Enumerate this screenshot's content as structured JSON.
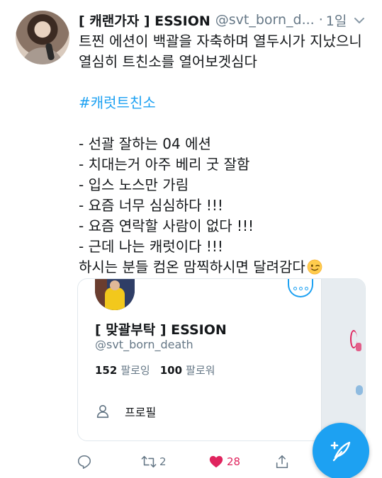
{
  "tweet": {
    "display_name": "[ 캐랜가자 ] ESSION",
    "handle": "@svt_born_d...",
    "separator": "·",
    "time": "1일",
    "lines": {
      "l1": "트찐 에션이 백괄을 자축하며 열두시가 지났으니",
      "l2": "열심히 트친소를 열어보겟심다",
      "hashtag": "#캐럿트친소",
      "l4": "- 선괄 잘하는 04 에션",
      "l5": "- 치대는거 아주 베리 굿 잘함",
      "l6": "- 입스 노스만 가림",
      "l7": "- 요즘 너무 심심하다 !!!",
      "l8": "- 요즘 연락할 사람이 없다 !!!",
      "l9": "- 근데 나는 캐럿이다 !!!",
      "l10": "하시는 분들 컴온 맘찍하시면 달려감다"
    },
    "emoji": "winking-face-emoji"
  },
  "card": {
    "name": "[ 맞괄부탁 ] ESSION",
    "handle": "@svt_born_death",
    "following_count": "152",
    "following_label": "팔로잉",
    "followers_count": "100",
    "followers_label": "팔로워",
    "profile_label": "프로필"
  },
  "actions": {
    "reply_icon": "reply-icon",
    "retweet_count": "2",
    "like_count": "28",
    "share_icon": "share-icon"
  },
  "colors": {
    "accent": "#1da1f2",
    "like": "#e0245e",
    "muted": "#657786",
    "text": "#14171a"
  }
}
